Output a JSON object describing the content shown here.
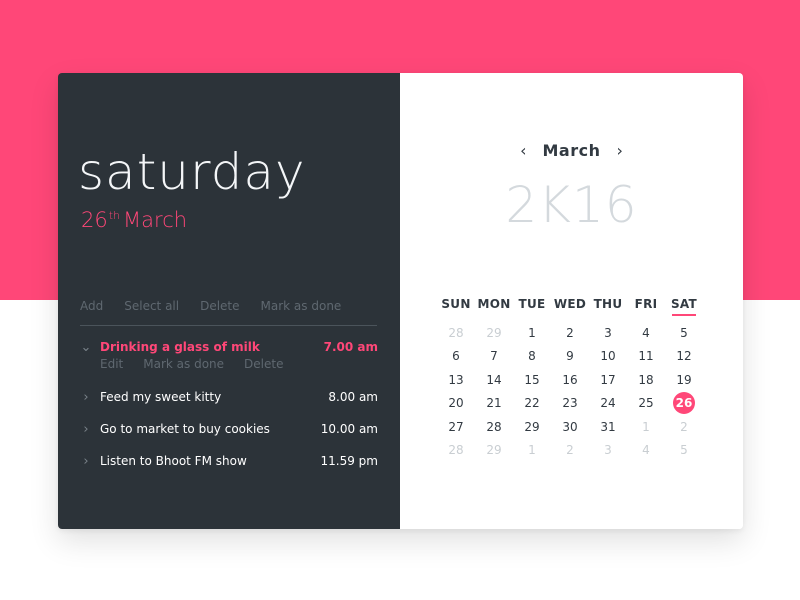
{
  "colors": {
    "accent": "#ff4778",
    "left_panel": "#2c3339",
    "right_panel": "#ffffff",
    "dark_text": "#323a42",
    "muted_text": "#c9ced2"
  },
  "left": {
    "day_name": "saturday",
    "date": {
      "day": "26",
      "suffix": "th",
      "month": "March"
    },
    "actions": [
      "Add",
      "Select all",
      "Delete",
      "Mark as done"
    ],
    "tasks": [
      {
        "title": "Drinking a glass of milk",
        "time": "7.00 am",
        "expanded": true,
        "icon": "chevron-down-icon"
      },
      {
        "title": "Feed my sweet kitty",
        "time": "8.00 am",
        "expanded": false,
        "icon": "chevron-right-icon"
      },
      {
        "title": "Go to market to buy cookies",
        "time": "10.00 am",
        "expanded": false,
        "icon": "chevron-right-icon"
      },
      {
        "title": "Listen to Bhoot FM show",
        "time": "11.59 pm",
        "expanded": false,
        "icon": "chevron-right-icon"
      }
    ],
    "task_actions": [
      "Edit",
      "Mark as done",
      "Delete"
    ]
  },
  "right": {
    "month": "March",
    "year": "2K16",
    "prev_icon": "chevron-left-icon",
    "next_icon": "chevron-right-icon",
    "weekdays": [
      "SUN",
      "MON",
      "TUE",
      "WED",
      "THU",
      "FRI",
      "SAT"
    ],
    "selected_weekday": "SAT",
    "weeks": [
      [
        {
          "d": "28",
          "m": true
        },
        {
          "d": "29",
          "m": true
        },
        {
          "d": "1"
        },
        {
          "d": "2"
        },
        {
          "d": "3"
        },
        {
          "d": "4"
        },
        {
          "d": "5"
        }
      ],
      [
        {
          "d": "6"
        },
        {
          "d": "7"
        },
        {
          "d": "8"
        },
        {
          "d": "9"
        },
        {
          "d": "10"
        },
        {
          "d": "11"
        },
        {
          "d": "12"
        }
      ],
      [
        {
          "d": "13"
        },
        {
          "d": "14"
        },
        {
          "d": "15"
        },
        {
          "d": "16"
        },
        {
          "d": "17"
        },
        {
          "d": "18"
        },
        {
          "d": "19"
        }
      ],
      [
        {
          "d": "20"
        },
        {
          "d": "21"
        },
        {
          "d": "22"
        },
        {
          "d": "23"
        },
        {
          "d": "24"
        },
        {
          "d": "25"
        },
        {
          "d": "26",
          "today": true
        }
      ],
      [
        {
          "d": "27"
        },
        {
          "d": "28"
        },
        {
          "d": "29"
        },
        {
          "d": "30"
        },
        {
          "d": "31"
        },
        {
          "d": "1",
          "m": true
        },
        {
          "d": "2",
          "m": true
        }
      ],
      [
        {
          "d": "28",
          "m": true
        },
        {
          "d": "29",
          "m": true
        },
        {
          "d": "1",
          "m": true
        },
        {
          "d": "2",
          "m": true
        },
        {
          "d": "3",
          "m": true
        },
        {
          "d": "4",
          "m": true
        },
        {
          "d": "5",
          "m": true
        }
      ]
    ]
  }
}
